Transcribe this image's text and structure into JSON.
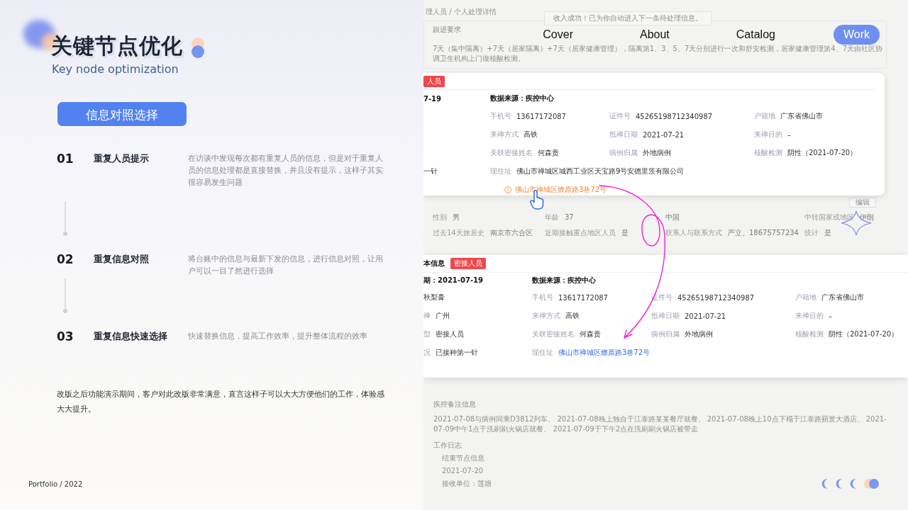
{
  "nav": [
    {
      "label": "Cover",
      "selected": false
    },
    {
      "label": "About",
      "selected": false
    },
    {
      "label": "Catalog",
      "selected": false
    },
    {
      "label": "Work",
      "selected": true
    }
  ],
  "slide": {
    "title": "关键节点优化",
    "subtitle": "Key node optimization",
    "section_button": "信息对照选择",
    "steps": [
      {
        "number": "01",
        "title": "重复人员提示",
        "description": "在访谈中发现每次都有重复人员的信息，但是对于重复人员的信息处理都是直接替换，并且没有提示，这样子其实很容易发生问题"
      },
      {
        "number": "02",
        "title": "重复信息对照",
        "description": "将台账中的信息与最新下发的信息，进行信息对照，让用户可以一目了然进行选择"
      },
      {
        "number": "03",
        "title": "重复信息快速选择",
        "description": "快速替换信息，提高工作效率，提升整体流程的效率"
      }
    ],
    "conclusion": "改版之后功能演示期间，客户对此改版非常满意，直言这样子可以大大方便他们的工作，体验感大大提升。",
    "footer": "Portfolio / 2022"
  },
  "background_screen": {
    "breadcrumb": "理人员 / 个人处理详情",
    "toast": "收入成功！已为你自动进入下一条待处理信息。",
    "follow_up_title": "跟进要求",
    "follow_up_text": "7天（集中隔离）+7天（居家隔离）+7天（居家健康管理），隔离第1、3、5、7天分别进行一次和舒安检测，居家健康管理第4、7天由社区协调卫生机构上门做核酸检测。",
    "edit_button": "编辑",
    "info_rows": [
      [
        {
          "label": "性别",
          "value": "男"
        },
        {
          "label": "年龄",
          "value": "37"
        },
        {
          "value": "中国"
        },
        {
          "label": "中转国家或地区",
          "value": "伊朗"
        }
      ],
      [
        {
          "label": "过去14天旅居史",
          "value": "南京市六合区"
        },
        {
          "label": "近期接触重点地区人员",
          "value": "是"
        },
        {
          "label": "联系人与联系方式",
          "value": "严立、18675757234"
        },
        {
          "label": "统计",
          "value": "是"
        }
      ]
    ],
    "notes_title": "疾控备注信息",
    "notes_text": "2021-07-08与病例同乘D3812列车、 2021-07-08晚上独自于江泰路某某餐厅就餐、 2021-07-08晚上10点下榻于江泰路丽景大酒店、 2021-07-09中午1点于洗刷刷火锅店就餐、 2021-07-09于下午2点在洗刷刷火锅店被带走",
    "log_title": "工作日志",
    "log_items": [
      "结束节点信息",
      "2021-07-20",
      "接收单位：莲塘"
    ]
  },
  "card_before": {
    "tag": "人员",
    "header_left": "7-19",
    "header_source": "数据来源：疾控中心",
    "rows": [
      {
        "fields": [
          {
            "label": "手机号",
            "value": "13617172087"
          },
          {
            "label": "证件号",
            "value": "45265198712340987"
          },
          {
            "label": "户籍地",
            "value": "广东省佛山市"
          }
        ]
      },
      {
        "fields": [
          {
            "label": "来禅方式",
            "value": "高铁"
          },
          {
            "label": "抵禅日期",
            "value": "2021-07-21"
          },
          {
            "label": "来禅目的",
            "value": "–"
          }
        ]
      },
      {
        "fields": [
          {
            "label": "关联密接姓名",
            "value": "何森贵"
          },
          {
            "label": "病例归属",
            "value": "外地病例"
          },
          {
            "label": "核酸检测",
            "value": "阴性（2021-07-20）"
          }
        ]
      }
    ],
    "address": {
      "left": {
        "value": "一针"
      },
      "label": "现住址",
      "value": "佛山市禅城区城西工业区天宝路9号安德里茨有限公司",
      "highlighted": false
    },
    "suggestion": "佛山市禅城区燎原路3巷72号"
  },
  "card_after": {
    "title": "本信息",
    "tag": "密接人员",
    "header_left": "期：2021-07-19",
    "header_source": "数据来源：疾控中心",
    "rows": [
      {
        "left": {
          "value": "秋梨膏"
        },
        "fields": [
          {
            "label": "手机号",
            "value": "13617172087"
          },
          {
            "label": "证件号",
            "value": "45265198712340987"
          },
          {
            "label": "户籍地",
            "value": "广东省佛山市"
          }
        ]
      },
      {
        "left": {
          "label": "禅",
          "value": "广州"
        },
        "fields": [
          {
            "label": "来禅方式",
            "value": "高铁"
          },
          {
            "label": "抵禅日期",
            "value": "2021-07-21"
          },
          {
            "label": "来禅目的",
            "value": "–"
          }
        ]
      },
      {
        "left": {
          "label": "型",
          "value": "密接人员"
        },
        "fields": [
          {
            "label": "关联密接姓名",
            "value": "何森贵"
          },
          {
            "label": "病例归属",
            "value": "外地病例"
          },
          {
            "label": "核酸检测",
            "value": "阴性（2021-07-20）"
          }
        ]
      }
    ],
    "address": {
      "left": {
        "label": "况",
        "value": "已接种第一针"
      },
      "label": "现住址",
      "value": "佛山市禅城区燎原路3巷72号",
      "highlighted": true
    }
  }
}
